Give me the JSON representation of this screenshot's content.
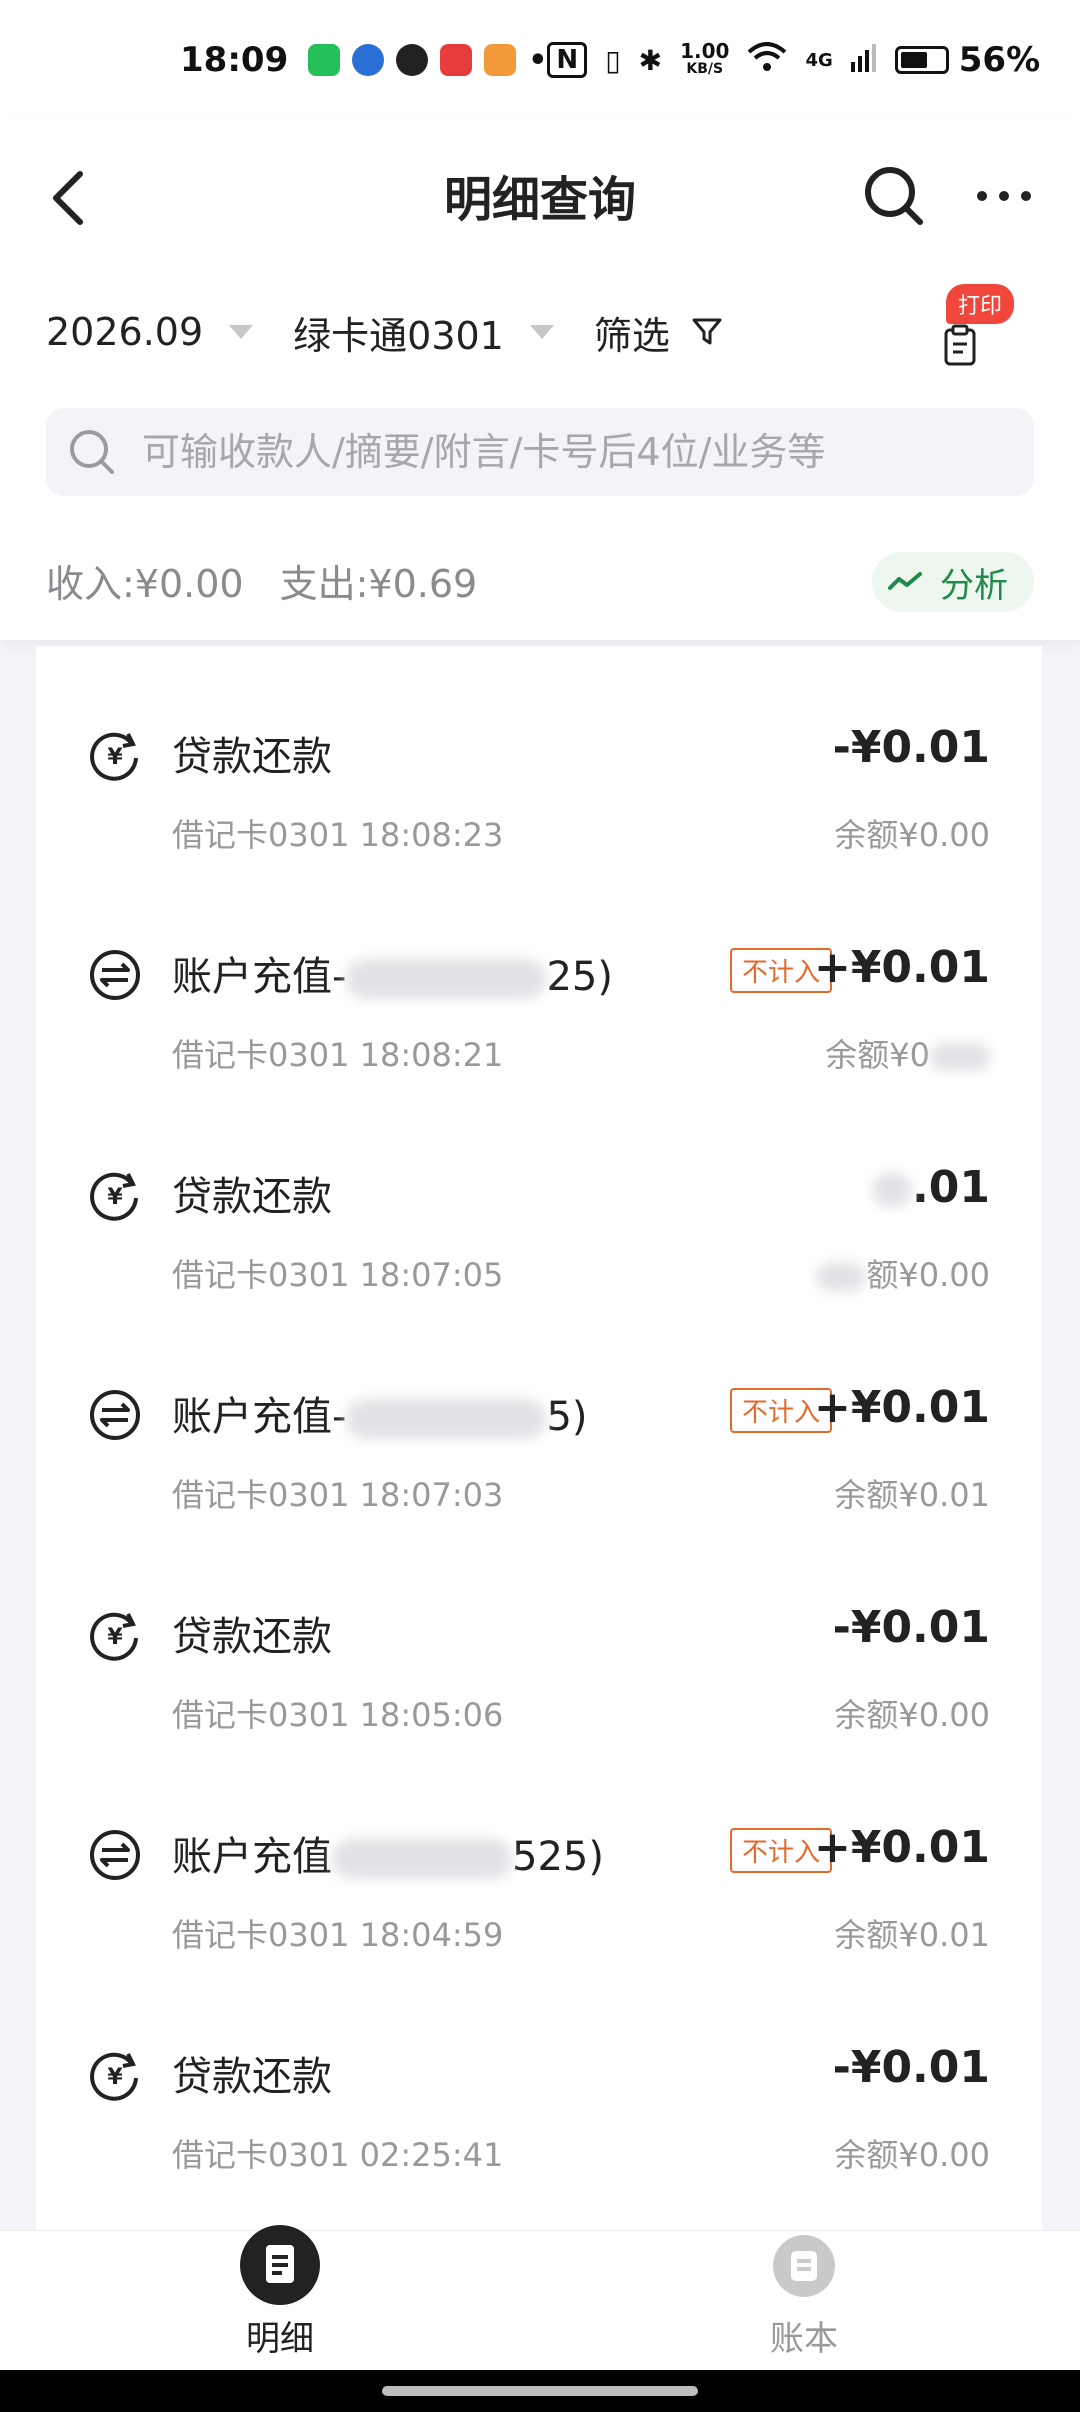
{
  "status_bar": {
    "time": "18:09",
    "net_speed_value": "1.00",
    "net_speed_unit": "KB/S",
    "network": "4G",
    "battery": "56%"
  },
  "nav": {
    "title": "明细查询"
  },
  "filters": {
    "month": "2026.09",
    "card": "绿卡通0301",
    "filter_label": "筛选",
    "print_badge": "打印"
  },
  "search": {
    "placeholder": "可输收款人/摘要/附言/卡号后4位/业务等"
  },
  "summary": {
    "income": "收入:¥0.00",
    "expense": "支出:¥0.69",
    "analysis": "分析"
  },
  "transactions": [
    {
      "icon": "loan-repay-icon",
      "title": "贷款还款",
      "sub": "借记卡0301 18:08:23",
      "amount": "-¥0.01",
      "balance": "余额¥0.00",
      "tag": ""
    },
    {
      "icon": "transfer-icon",
      "title": "账户充值-",
      "title_tail": "25)",
      "sub": "借记卡0301 18:08:21",
      "amount": "+¥0.01",
      "balance": "余额¥0",
      "tag": "不计入"
    },
    {
      "icon": "loan-repay-icon",
      "title": "贷款还款",
      "sub": "借记卡0301 18:07:05",
      "amount": ".01",
      "balance": "额¥0.00",
      "tag": ""
    },
    {
      "icon": "transfer-icon",
      "title": "账户充值-",
      "title_tail": "5)",
      "sub": "借记卡0301 18:07:03",
      "amount": "+¥0.01",
      "balance": "余额¥0.01",
      "tag": "不计入"
    },
    {
      "icon": "loan-repay-icon",
      "title": "贷款还款",
      "sub": "借记卡0301 18:05:06",
      "amount": "-¥0.01",
      "balance": "余额¥0.00",
      "tag": ""
    },
    {
      "icon": "transfer-icon",
      "title": "账户充值",
      "title_tail": "525)",
      "sub": "借记卡0301 18:04:59",
      "amount": "+¥0.01",
      "balance": "余额¥0.01",
      "tag": "不计入"
    },
    {
      "icon": "loan-repay-icon",
      "title": "贷款还款",
      "sub": "借记卡0301 02:25:41",
      "amount": "-¥0.01",
      "balance": "余额¥0.00",
      "tag": ""
    }
  ],
  "tabbar": {
    "detail": "明细",
    "ledger": "账本"
  },
  "colors": {
    "accent_green": "#1f8a4a",
    "tag_orange": "#e46a2a",
    "badge_red": "#f0463c"
  }
}
